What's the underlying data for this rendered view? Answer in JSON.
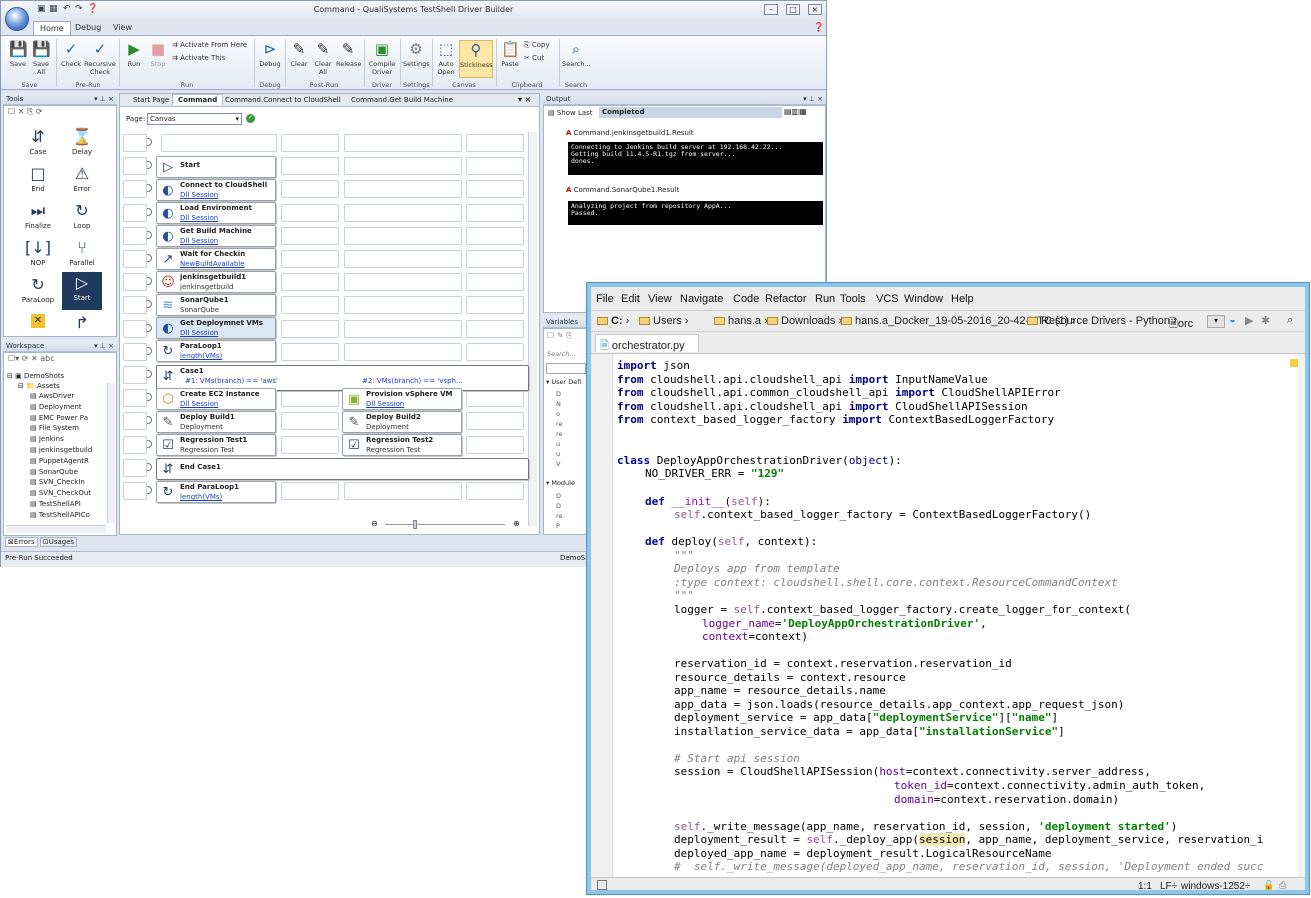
{
  "builder": {
    "title": "Command - QualiSystems TestShell Driver Builder",
    "ribbon_tabs": [
      "Home",
      "Debug",
      "View"
    ],
    "ribbon": {
      "save": "Save",
      "save_all": "Save All",
      "check": "Check",
      "recursive_check": "Recursive Check",
      "run": "Run",
      "stop": "Stop",
      "activate_from_here": "Activate From Here",
      "activate_this": "Activate This",
      "debug": "Debug",
      "clear": "Clear",
      "clear_all": "Clear All",
      "release": "Release",
      "compile_driver": "Compile Driver",
      "settings": "Settings",
      "auto_open": "Auto Open",
      "stickiness": "Stickiness",
      "paste": "Paste",
      "copy": "Copy",
      "cut": "Cut",
      "search": "Search...",
      "groups": {
        "save": "Save",
        "pre_run": "Pre-Run",
        "run": "Run",
        "debug": "Debug",
        "post_run": "Post-Run",
        "driver": "Driver",
        "settings": "Settings",
        "canvas": "Canvas",
        "clipboard": "Clipboard",
        "search": "Search"
      }
    },
    "tools_panel": {
      "title": "Tools",
      "items": [
        "Case",
        "Delay",
        "End",
        "Error",
        "Finalize",
        "Loop",
        "NOP",
        "Parallel",
        "ParaLoop",
        "Start"
      ]
    },
    "workspace": {
      "title": "Workspace",
      "root": "DemoShots",
      "folder": "Assets",
      "items": [
        "AwsDriver",
        "Deployment",
        "EMC Power Pa",
        "File System",
        "Jenkins",
        "jenkinsgetbuild",
        "PuppetAgentR",
        "SonarQube",
        "SVN_CheckIn",
        "SVN_CheckOut",
        "TestShellAPI",
        "TestShellAPICo"
      ]
    },
    "bottom_tabs": [
      "Errors",
      "Usages"
    ],
    "status": "Pre-Run Succeeded",
    "status_right": "DemoSh",
    "doc_tabs": [
      "Start Page",
      "Command",
      "Command.Connect to CloudShell",
      "Command.Get Build Machine"
    ],
    "page_label": "Page:",
    "page_value": "Canvas",
    "activities": {
      "start": "Start",
      "connect": {
        "name": "Connect to CloudShell",
        "sub": "Dll Session"
      },
      "load": {
        "name": "Load Environment",
        "sub": "Dll Session"
      },
      "getbuild": {
        "name": "Get Build Machine",
        "sub": "Dll Session"
      },
      "wait": {
        "name": "Wait for Checkin",
        "sub": "NewBuildAvailable"
      },
      "jenkins": {
        "name": "jenkinsgetbuild1",
        "sub": "jenkinsgetbuild"
      },
      "sonar": {
        "name": "SonarQube1",
        "sub": "SonarQube"
      },
      "deploy_vms": {
        "name": "Get Deploymnet VMs",
        "sub": "Dll Session"
      },
      "paraloop": {
        "name": "ParaLoop1",
        "sub": "length(VMs)"
      },
      "case": {
        "name": "Case1",
        "c1": "#1: VMs(branch) == 'aws'",
        "c2": "#2: VMs(branch) == 'vsph..."
      },
      "ec2": {
        "name": "Create EC2 Instance",
        "sub": "Dll Session"
      },
      "vsphere": {
        "name": "Provision vSphere VM",
        "sub": "Dll Session"
      },
      "deploy1": {
        "name": "Deploy Build1",
        "sub": "Deployment"
      },
      "deploy2": {
        "name": "Deploy Build2",
        "sub": "Deployment"
      },
      "reg1": {
        "name": "Regression Test1",
        "sub": "Regression Test"
      },
      "reg2": {
        "name": "Regression Test2",
        "sub": "Regression Test"
      },
      "endcase": "End Case1",
      "endparaloop": {
        "name": "End ParaLoop1",
        "sub": "length(VMs)"
      }
    },
    "output": {
      "title": "Output",
      "show_last": "Show Last",
      "filter": "Completed",
      "r1": "Command.jenkinsgetbuild1.Result",
      "r1_text": "Connecting to Jenkins build server at 192.168.42.22...\nGetting build 11.4.5-R1.tgz from server...\ndones.",
      "r2": "Command.SonarQube1.Result",
      "r2_text": "Analyzing project from repository AppA...\nPassed."
    },
    "variables": {
      "title": "Variables",
      "search": "Search...",
      "user_def": "User Defi",
      "module": "Module"
    }
  },
  "pycharm": {
    "menu": [
      "File",
      "Edit",
      "View",
      "Navigate",
      "Code",
      "Refactor",
      "Run",
      "Tools",
      "VCS",
      "Window",
      "Help"
    ],
    "breadcrumbs": [
      "C:",
      "Users",
      "hans.a",
      "Downloads",
      "hans.a_Docker_19-05-2016_20-42-UTC (1)",
      "Resource Drivers - Python",
      "orc"
    ],
    "tab": "orchestrator.py",
    "status": {
      "pos": "1:1",
      "lf": "LF÷",
      "enc": "windows-1252÷"
    },
    "code": [
      "import json",
      "from cloudshell.api.cloudshell_api import InputNameValue",
      "from cloudshell.api.common_cloudshell_api import CloudShellAPIError",
      "from cloudshell.api.cloudshell_api import CloudShellAPISession",
      "from context_based_logger_factory import ContextBasedLoggerFactory",
      "class DeployAppOrchestrationDriver(object):",
      "NO_DRIVER_ERR = \"129\"",
      "def __init__(self):",
      "self.context_based_logger_factory = ContextBasedLoggerFactory()",
      "def deploy(self, context):",
      "\"\"\"",
      "Deploys app from template",
      ":type context: cloudshell.shell.core.context.ResourceCommandContext",
      "\"\"\"",
      "logger = self.context_based_logger_factory.create_logger_for_context(",
      "logger_name='DeployAppOrchestrationDriver',",
      "context=context)",
      "reservation_id = context.reservation.reservation_id",
      "resource_details = context.resource",
      "app_name = resource_details.name",
      "app_data = json.loads(resource_details.app_context.app_request_json)",
      "deployment_service = app_data[\"deploymentService\"][\"name\"]",
      "installation_service_data = app_data[\"installationService\"]",
      "# Start api session",
      "session = CloudShellAPISession(host=context.connectivity.server_address,",
      "token_id=context.connectivity.admin_auth_token,",
      "domain=context.reservation.domain)",
      "self._write_message(app_name, reservation_id, session, 'deployment started')",
      "deployment_result = self._deploy_app(session, app_name, deployment_service, reservation_i",
      "deployed_app_name = deployment_result.LogicalResourceName",
      "#  self._write_message(deployed_app_name, reservation_id, session, 'Deployment ended succ"
    ]
  }
}
